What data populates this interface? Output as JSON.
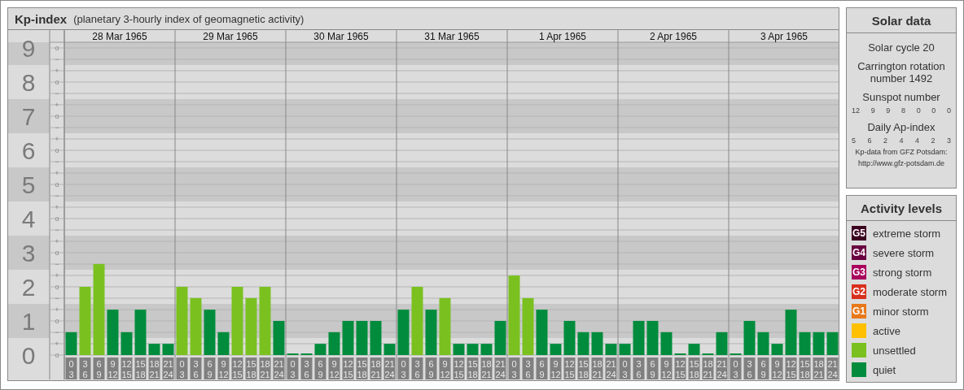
{
  "header": {
    "title": "Kp-index",
    "subtitle": "(planetary 3-hourly index of geomagnetic activity)"
  },
  "chart": {
    "days": [
      "28 Mar 1965",
      "29 Mar 1965",
      "30 Mar 1965",
      "31 Mar 1965",
      "1 Apr 1965",
      "2 Apr 1965",
      "3 Apr 1965"
    ],
    "minor_tick_labels": [
      "o",
      "−",
      "+",
      "o",
      "−",
      "+",
      "o",
      "−",
      "+",
      "o",
      "−",
      "+",
      "o",
      "−",
      "+",
      "o",
      "−",
      "+",
      "o",
      "−",
      "+",
      "o",
      "−",
      "+",
      "o",
      "−",
      "+",
      "o"
    ],
    "chart_data": {
      "type": "bar",
      "stacked": true,
      "grid": true,
      "ylim": [
        0,
        9
      ],
      "yticks": [
        {
          "value": 0,
          "label": "0"
        },
        {
          "value": 1,
          "label": "1"
        },
        {
          "value": 2,
          "label": "2"
        },
        {
          "value": 3,
          "label": "3"
        },
        {
          "value": 4,
          "label": "4"
        },
        {
          "value": 5,
          "label": "5"
        },
        {
          "value": 6,
          "label": "6"
        },
        {
          "value": 7,
          "label": "7"
        },
        {
          "value": 8,
          "label": "8"
        },
        {
          "value": 9,
          "label": "9"
        }
      ],
      "categories": [
        "0 3",
        "3 6",
        "6 9",
        "9 12",
        "12 15",
        "15 18",
        "18 21",
        "21 24",
        "0 3",
        "3 6",
        "6 9",
        "9 12",
        "12 15",
        "15 18",
        "18 21",
        "21 24",
        "0 3",
        "3 6",
        "6 9",
        "9 12",
        "12 15",
        "15 18",
        "18 21",
        "21 24",
        "0 3",
        "3 6",
        "6 9",
        "9 12",
        "12 15",
        "15 18",
        "18 21",
        "21 24",
        "0 3",
        "3 6",
        "6 9",
        "9 12",
        "12 15",
        "15 18",
        "18 21",
        "21 24",
        "0 3",
        "3 6",
        "6 9",
        "9 12",
        "12 15",
        "15 18",
        "18 21",
        "21 24",
        "0 3",
        "3 6",
        "6 9",
        "9 12",
        "12 15",
        "15 18",
        "18 21",
        "21 24"
      ],
      "series": [
        {
          "name": "quiet",
          "color": "#008c3c",
          "values": [
            0.67,
            null,
            null,
            1.33,
            0.67,
            1.33,
            0.33,
            0.33,
            null,
            null,
            1.33,
            0.67,
            null,
            null,
            null,
            1,
            0,
            0,
            0.33,
            0.67,
            1,
            1,
            1,
            0.33,
            1.33,
            null,
            1.33,
            null,
            0.33,
            0.33,
            0.33,
            1,
            null,
            null,
            1.33,
            0.33,
            1,
            0.67,
            0.67,
            0.33,
            0.33,
            1,
            1,
            0.67,
            0,
            0.33,
            0,
            0.67,
            0,
            1,
            0.67,
            0.33,
            1.33,
            0.67,
            0.67,
            0.67
          ]
        },
        {
          "name": "unsettled",
          "color": "#7ac120",
          "values": [
            null,
            2,
            2.67,
            null,
            null,
            null,
            null,
            null,
            2,
            1.67,
            null,
            null,
            2,
            1.67,
            2,
            null,
            null,
            null,
            null,
            null,
            null,
            null,
            null,
            null,
            null,
            2,
            null,
            1.67,
            null,
            null,
            null,
            null,
            2.33,
            1.67,
            null,
            null,
            null,
            null,
            null,
            null,
            null,
            null,
            null,
            null,
            null,
            null,
            null,
            null,
            null,
            null,
            null,
            null,
            null,
            null,
            null,
            null
          ]
        }
      ]
    }
  },
  "solar_data": {
    "title": "Solar data",
    "cycle": "Solar cycle 20",
    "rotation": "Carrington rotation number 1492",
    "sunspot_title": "Sunspot number",
    "sunspots": [
      "12",
      "9",
      "9",
      "8",
      "0",
      "0",
      "0"
    ],
    "ap_title": "Daily Ap-index",
    "ap": [
      "5",
      "6",
      "2",
      "4",
      "4",
      "2",
      "3"
    ],
    "source": "Kp-data from GFZ Potsdam:",
    "source_url": "http://www.gfz-potsdam.de"
  },
  "activity_levels": {
    "title": "Activity levels",
    "items": [
      {
        "badge": "G5",
        "label": "extreme storm",
        "color": "#3c0020"
      },
      {
        "badge": "G4",
        "label": "severe storm",
        "color": "#6a0040"
      },
      {
        "badge": "G3",
        "label": "strong storm",
        "color": "#a8005c"
      },
      {
        "badge": "G2",
        "label": "moderate storm",
        "color": "#d8301c"
      },
      {
        "badge": "G1",
        "label": "minor storm",
        "color": "#e8781a"
      },
      {
        "label": "active",
        "color": "#ffc000"
      }
    ]
  }
}
